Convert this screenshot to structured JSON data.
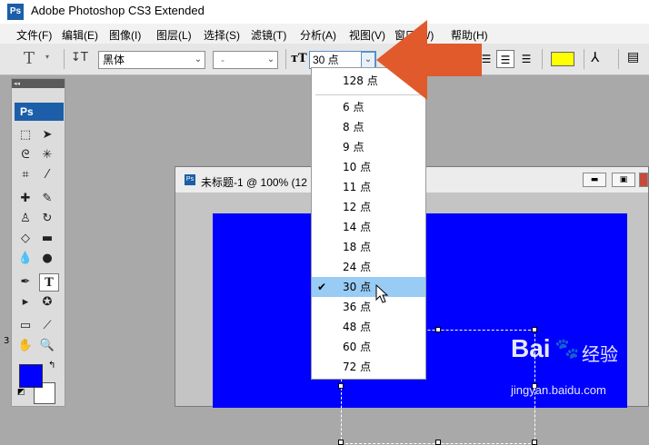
{
  "window": {
    "title": "Adobe Photoshop CS3 Extended",
    "logo": "Ps"
  },
  "menu": [
    "文件(F)",
    "编辑(E)",
    "图像(I)",
    "图层(L)",
    "选择(S)",
    "滤镜(T)",
    "分析(A)",
    "视图(V)",
    "窗口(W)",
    "帮助(H)"
  ],
  "options": {
    "tool_icon": "text-tool-icon",
    "font_family": "黑体",
    "font_style": "-",
    "font_size": "30 点"
  },
  "colors": {
    "foreground": "#0000ff",
    "background": "#ffffff",
    "swatch": "#ffff00",
    "canvas": "#0000ff",
    "selection": "#99ccf5",
    "arrow": "#e05a2b"
  },
  "toolbox": {
    "logo": "Ps"
  },
  "document": {
    "title": "未标题-1 @ 100% (12",
    "zoom": "100%"
  },
  "font_size_options": [
    "128 点",
    "6 点",
    "8 点",
    "9 点",
    "10 点",
    "11 点",
    "12 点",
    "14 点",
    "18 点",
    "24 点",
    "30 点",
    "36 点",
    "48 点",
    "60 点",
    "72 点"
  ],
  "selected_size": "30 点",
  "watermark": {
    "brand": "Bai",
    "brand2": "经验",
    "url": "jingyan.baidu.com"
  }
}
